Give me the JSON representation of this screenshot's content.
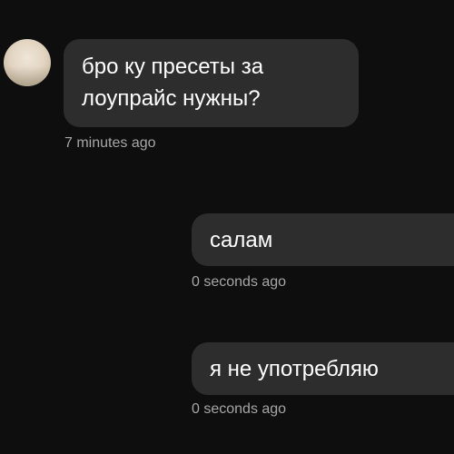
{
  "messages": [
    {
      "direction": "incoming",
      "lines": [
        "бро ку пресеты за",
        "лоупрайс нужны?"
      ],
      "time": "7 minutes ago"
    },
    {
      "direction": "outgoing",
      "text": "салам",
      "time": "0 seconds ago"
    },
    {
      "direction": "outgoing",
      "text": "я не употребляю",
      "time": "0 seconds ago"
    }
  ],
  "colors": {
    "background": "#0f0e0f",
    "bubble": "#2e2d2e",
    "text": "#ffffff",
    "timestamp": "#a6a6a6"
  },
  "icons": {
    "avatar": "sender-avatar"
  }
}
